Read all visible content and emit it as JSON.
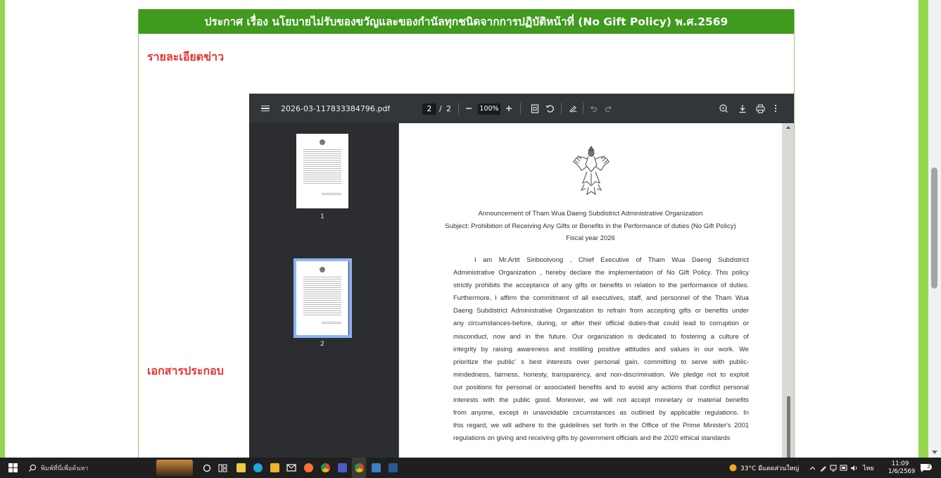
{
  "page": {
    "title": "ประกาศ เรื่อง นโยบายไม่รับของขวัญและของกำนัลทุกชนิดจากการปฏิบัติหน้าที่ (No Gift Policy) พ.ศ.2569",
    "news_details_label": "รายละเอียดข่าว",
    "attachments_label": "เอกสารประกอบ"
  },
  "viewer": {
    "file_name": "2026-03-117833384796.pdf",
    "current_page": "2",
    "page_separator": "/",
    "total_pages": "2",
    "zoom": "100%",
    "zoom_out_icon": "minus-icon",
    "zoom_in_icon": "plus-icon",
    "thumbnails": [
      {
        "label": "1",
        "selected": false
      },
      {
        "label": "2",
        "selected": true
      }
    ]
  },
  "document": {
    "heading_line1": "Announcement of Tham Wua Daeng Subdistrict Administrative Organization",
    "heading_line2": "Subject: Prohibition of Receiving Any Gifts or Benefits in the Performance of duties (No Gift Policy)",
    "heading_line3": "Fiscal year 2026",
    "body_lines": [
      "I am Mr.Artit Siribootvong , Chief Executive of Tham Wua Daeng Subdistrict",
      "Administrative Organization , hereby declare the implementation of No Gift Policy. This policy",
      "strictly prohibits the acceptance of any gifts or benefits in relation to the performance of duties.",
      "Furthermore, I affirm the commitment of all executives, staff, and personnel of the Tham Wua",
      "Daeng Subdistrict Administrative Organization to refrain from accepting gifts or benefits under",
      "any circumstances-before, during, or after their official duties-that could lead to corruption or",
      "misconduct, now and in the future. Our organization is dedicated to fostering a culture of",
      "integrity by raising awareness and instilling positive attitudes and values in our work. We",
      "prioritize the public' s best interests over personal gain, committing to serve with public-",
      "mindedness, fairness, honesty, transparency, and non-discrimination. We pledge not to exploit",
      "our positions for personal or associated benefits and to avoid any actions that conflict personal",
      "interests with the public good. Moreover, we will not accept monetary or material benefits",
      "from anyone, except in unavoidable circumstances as outlined by applicable regulations. In",
      "this regard, we will adhere to the guidelines set forth in the Office of the Prime Minister's 2001",
      "regulations on giving and receiving gifts by government officials and the 2020 ethical standards"
    ]
  },
  "taskbar": {
    "search_placeholder": "พิมพ์ที่นี่เพื่อค้นหา",
    "weather": "33°C มีแดดส่วนใหญ่",
    "language": "ไทย",
    "time": "11:09",
    "date": "1/6/2569",
    "notification_count": "2"
  },
  "colors": {
    "title_bar": "#3f9a1d",
    "accent_border": "#94d64f",
    "label_red": "#e9322d",
    "viewer_toolbar": "#323639",
    "viewer_sidebar": "#2b2d30",
    "thumb_selected": "#8ab4f8"
  }
}
